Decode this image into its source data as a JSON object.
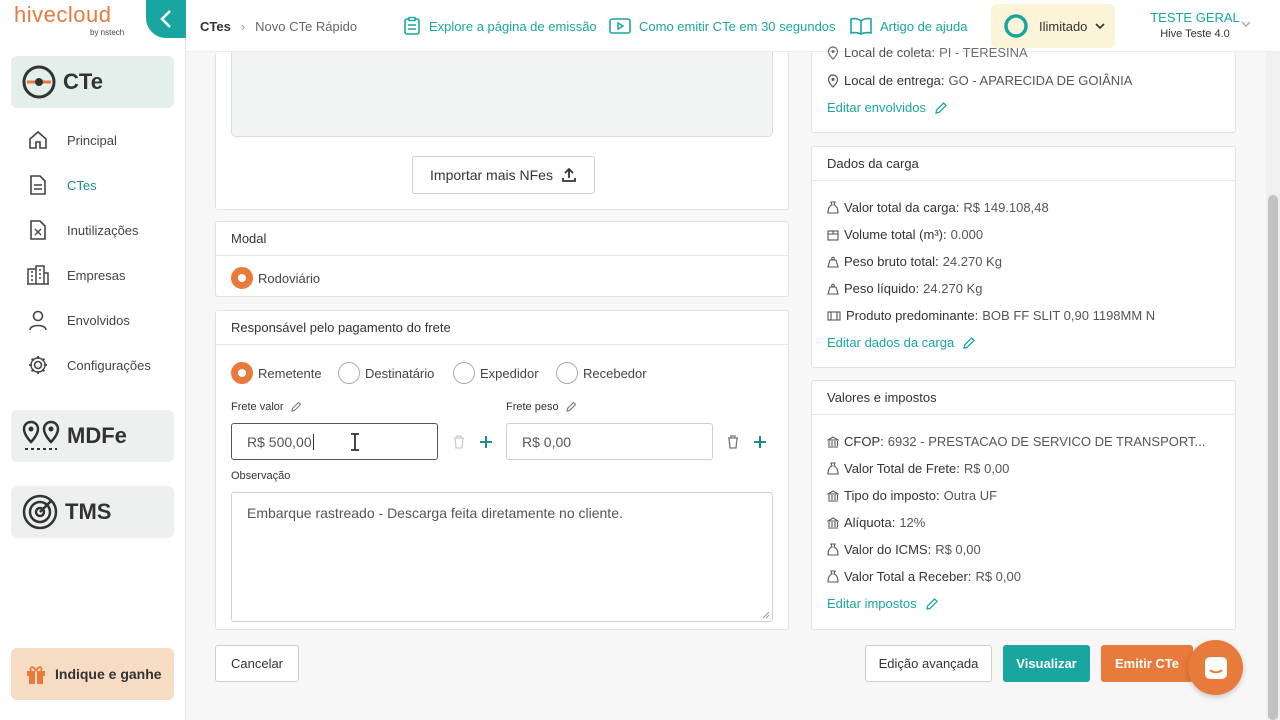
{
  "brand": {
    "name": "hivecloud",
    "sub": "by nstech"
  },
  "sidebar": {
    "cte_title": "CTe",
    "items": [
      {
        "label": "Principal",
        "icon": "home-icon"
      },
      {
        "label": "CTes",
        "icon": "document-icon"
      },
      {
        "label": "Inutilizações",
        "icon": "document-x-icon"
      },
      {
        "label": "Empresas",
        "icon": "buildings-icon"
      },
      {
        "label": "Envolvidos",
        "icon": "person-icon"
      },
      {
        "label": "Configurações",
        "icon": "gear-icon"
      }
    ],
    "mdfe_title": "MDFe",
    "tms_title": "TMS",
    "indique_label": "Indique e ganhe"
  },
  "topbar": {
    "breadcrumb_root": "CTes",
    "breadcrumb_current": "Novo CTe Rápido",
    "link_explore": "Explore a página de emissão",
    "link_video": "Como emitir CTe em 30 segundos",
    "link_article": "Artigo de ajuda",
    "plan_label": "Ilimitado",
    "user_name": "TESTE GERAL",
    "user_sub": "Hive Teste 4.0"
  },
  "main": {
    "import_button": "Importar mais NFes",
    "modal_title": "Modal",
    "modal_option": "Rodoviário",
    "payer_title": "Responsável pelo pagamento do frete",
    "payer_options": [
      "Remetente",
      "Destinatário",
      "Expedidor",
      "Recebedor"
    ],
    "frete_valor_label": "Frete valor",
    "frete_valor_value": "R$ 500,00",
    "frete_peso_label": "Frete peso",
    "frete_peso_value": "R$ 0,00",
    "observacao_label": "Observação",
    "observacao_value": "Embarque rastreado - Descarga feita diretamente no cliente."
  },
  "right": {
    "coleta_label": "Local de coleta:",
    "coleta_value": "PI - TERESINA",
    "entrega_label": "Local de entrega:",
    "entrega_value": "GO - APARECIDA DE GOIÂNIA",
    "edit_envolvidos": "Editar envolvidos",
    "carga_title": "Dados da carga",
    "carga": [
      {
        "label": "Valor total da carga:",
        "value": "R$ 149.108,48",
        "icon": "money-bag-icon"
      },
      {
        "label": "Volume total (m³):",
        "value": "0.000",
        "icon": "box-icon"
      },
      {
        "label": "Peso bruto total:",
        "value": "24.270 Kg",
        "icon": "weight-icon"
      },
      {
        "label": "Peso líquido:",
        "value": "24.270 Kg",
        "icon": "weight-icon"
      },
      {
        "label": "Produto predominante:",
        "value": "BOB FF SLIT 0,90 1198MM N",
        "icon": "package-icon"
      }
    ],
    "edit_carga": "Editar dados da carga",
    "impostos_title": "Valores e impostos",
    "impostos": [
      {
        "label": "CFOP:",
        "value": "6932 - PRESTACAO DE SERVICO DE TRANSPORT...",
        "icon": "bank-icon"
      },
      {
        "label": "Valor Total de Frete:",
        "value": "R$ 0,00",
        "icon": "money-bag-icon"
      },
      {
        "label": "Tipo do imposto:",
        "value": "Outra UF",
        "icon": "bank-icon"
      },
      {
        "label": "Alíquota:",
        "value": "12%",
        "icon": "bank-icon"
      },
      {
        "label": "Valor do ICMS:",
        "value": "R$ 0,00",
        "icon": "money-bag-icon"
      },
      {
        "label": "Valor Total a Receber:",
        "value": "R$ 0,00",
        "icon": "money-bag-icon"
      }
    ],
    "edit_impostos": "Editar impostos"
  },
  "footer": {
    "cancel": "Cancelar",
    "advanced": "Edição avançada",
    "preview": "Visualizar",
    "emit": "Emitir CTe"
  },
  "colors": {
    "accent": "#1aa6a0",
    "orange": "#e87a3c",
    "plan_bg": "#fbf4d9"
  }
}
